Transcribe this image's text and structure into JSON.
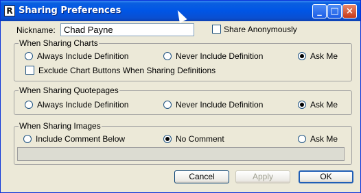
{
  "window": {
    "title": "Sharing Preferences",
    "app_icon": "R",
    "minimize": "_",
    "maximize": "□",
    "close": "×"
  },
  "nickname": {
    "label": "Nickname:",
    "value": "Chad Payne"
  },
  "share_anonymously": {
    "label": "Share Anonymously",
    "checked": false
  },
  "charts": {
    "title": "When Sharing Charts",
    "options": [
      "Always Include Definition",
      "Never Include Definition",
      "Ask Me"
    ],
    "selected": "Ask Me",
    "exclude_label": "Exclude Chart Buttons When Sharing Definitions",
    "exclude_checked": false
  },
  "quotepages": {
    "title": "When Sharing Quotepages",
    "options": [
      "Always Include Definition",
      "Never Include Definition",
      "Ask Me"
    ],
    "selected": "Ask Me"
  },
  "images": {
    "title": "When Sharing Images",
    "options": [
      "Include Comment Below",
      "No Comment",
      "Ask Me"
    ],
    "selected": "No Comment",
    "comment": ""
  },
  "buttons": {
    "cancel": "Cancel",
    "apply": "Apply",
    "ok": "OK"
  },
  "colors": {
    "titlebar": "#0055e5",
    "face": "#ece9d8",
    "close": "#c63a19"
  }
}
